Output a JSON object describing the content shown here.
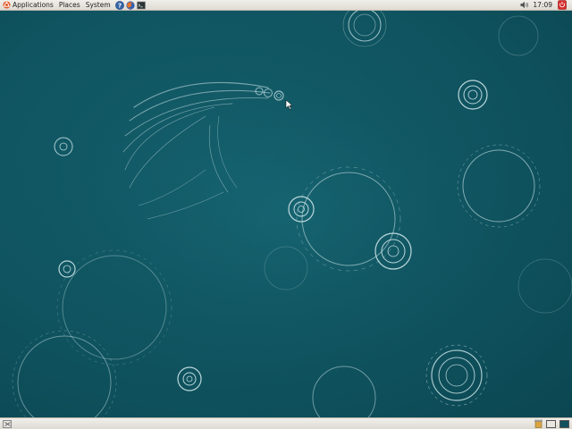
{
  "top_panel": {
    "menus": [
      "Applications",
      "Places",
      "System"
    ],
    "clock": "17:09"
  },
  "launchers": [
    {
      "icon": "help-icon"
    },
    {
      "icon": "firefox-icon"
    },
    {
      "icon": "terminal-icon"
    }
  ],
  "tray": {
    "volume_icon": "volume-icon",
    "power_icon": "shutdown-icon"
  },
  "bottom_panel": {
    "show_desktop_icon": "show-desktop-icon",
    "trash_icon": "trash-icon",
    "workspaces": [
      "workspace-1",
      "workspace-2"
    ]
  },
  "colors": {
    "desktop_background": "#11515e",
    "panel": "#e6e3dc",
    "ripple": "#cfe6ea",
    "ubuntu_logo": "#e05a2a",
    "power_button": "#d62b2b",
    "workspace_active": "#11515e"
  }
}
